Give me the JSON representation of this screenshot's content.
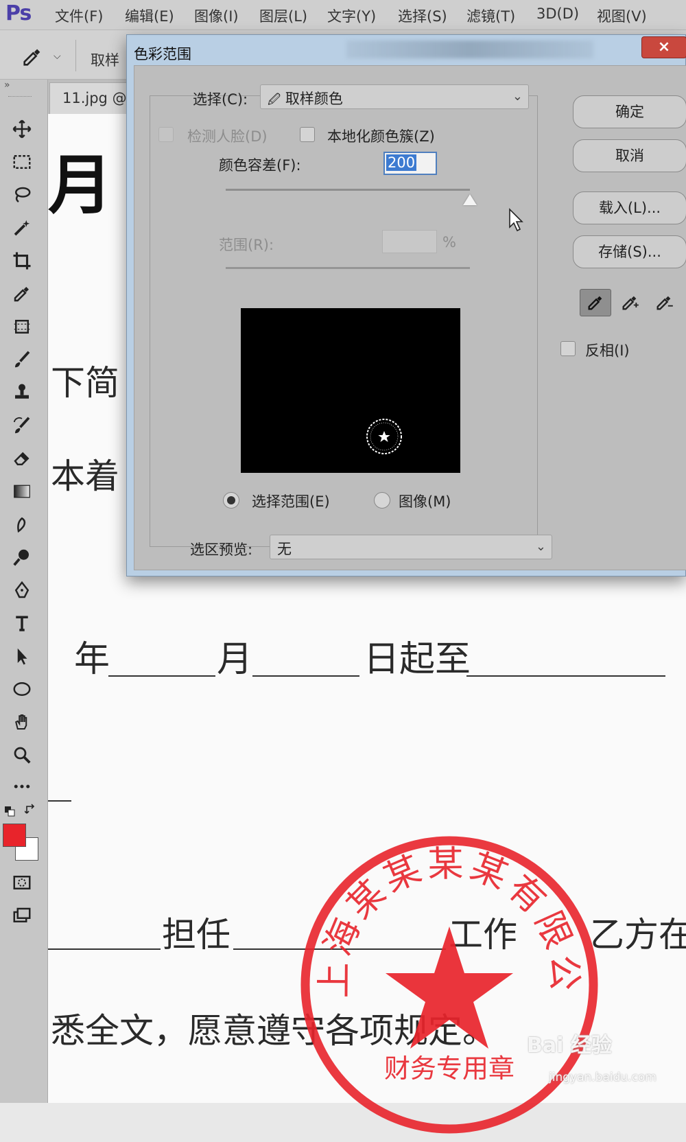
{
  "app": {
    "logo": "Ps"
  },
  "menu": [
    "文件(F)",
    "编辑(E)",
    "图像(I)",
    "图层(L)",
    "文字(Y)",
    "选择(S)",
    "滤镜(T)",
    "3D(D)",
    "视图(V)"
  ],
  "options_bar": {
    "label": "取样",
    "tool_icon": "eyedropper-icon"
  },
  "document": {
    "tab": "11.jpg @",
    "lines": [
      "月",
      "下简",
      "本着",
      "年",
      "月",
      "日起至",
      "担任",
      "工作",
      "乙方在",
      "悉全文，愿意遵守各项规定。"
    ],
    "stamp": {
      "company": "上海某某某某有限公司",
      "subtitle": "财务专用章",
      "color": "#e8242b"
    }
  },
  "dialog": {
    "title": "色彩范围",
    "close": "×",
    "select_label": "选择(C):",
    "select_value": "取样颜色",
    "detect_faces": "检测人脸(D)",
    "localized_clusters": "本地化颜色簇(Z)",
    "fuzziness_label": "颜色容差(F):",
    "fuzziness_value": "200",
    "fuzziness_level": 1.0,
    "range_label": "范围(R):",
    "range_unit": "%",
    "view_selection": "选择范围(E)",
    "view_image": "图像(M)",
    "preview_label": "选区预览:",
    "preview_value": "无",
    "buttons": {
      "ok": "确定",
      "cancel": "取消",
      "load": "载入(L)...",
      "save": "存储(S)..."
    },
    "invert": "反相(I)"
  },
  "colors": {
    "foreground": "#e8242b",
    "background": "#ffffff"
  },
  "watermark": {
    "brand": "Bai 经验",
    "url": "jingyan.baidu.com"
  }
}
